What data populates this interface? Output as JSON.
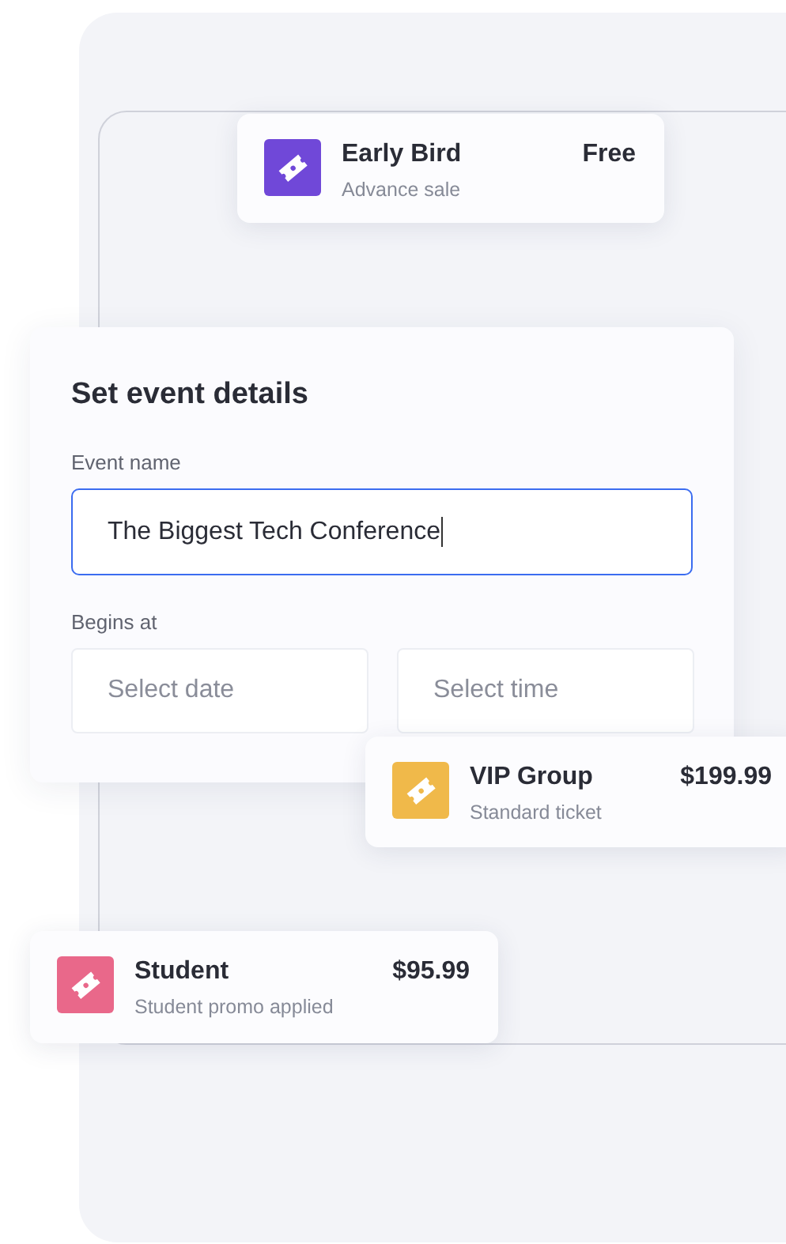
{
  "tickets": [
    {
      "name": "Early Bird",
      "note": "Advance sale",
      "price": "Free",
      "color": "#7048d8"
    },
    {
      "name": "VIP Group",
      "note": "Standard ticket",
      "price": "$199.99",
      "color": "#f0b94a"
    },
    {
      "name": "Student",
      "note": "Student promo applied",
      "price": "$95.99",
      "color": "#e9688a"
    }
  ],
  "form": {
    "title": "Set event details",
    "name_label": "Event name",
    "name_value": "The Biggest Tech Conference",
    "name_focused": true,
    "begins_label": "Begins at",
    "date_placeholder": "Select date",
    "time_placeholder": "Select time"
  }
}
